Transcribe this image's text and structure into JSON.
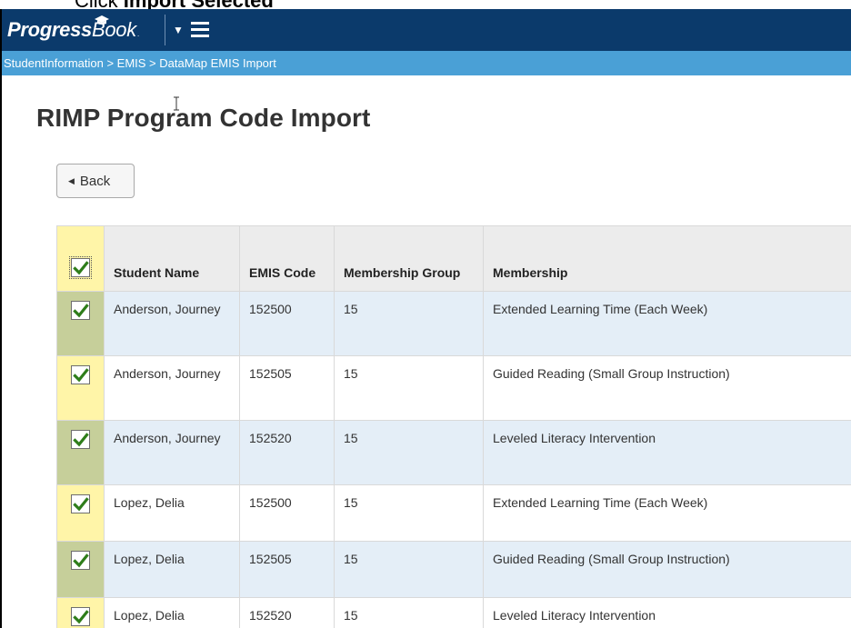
{
  "instruction": {
    "prefix": "Click ",
    "bold": "Import Selected"
  },
  "header": {
    "logo_bold": "Progress",
    "logo_regular": "Book"
  },
  "breadcrumb": "StudentInformation > EMIS > DataMap EMIS Import",
  "page_title": "RIMP Program Code Import",
  "back_button": "Back",
  "colors": {
    "topbar": "#0b3a6b",
    "breadcrumb_bar": "#4aa0d6",
    "highlight": "#fff5a8",
    "check": "#2e7d1a"
  },
  "table": {
    "columns": {
      "student_name": "Student Name",
      "emis_code": "EMIS Code",
      "membership_group": "Membership Group",
      "membership": "Membership"
    },
    "rows": [
      {
        "student_name": "Anderson, Journey",
        "emis_code": "152500",
        "membership_group": "15",
        "membership": "Extended Learning Time (Each Week)",
        "checked": true
      },
      {
        "student_name": "Anderson, Journey",
        "emis_code": "152505",
        "membership_group": "15",
        "membership": "Guided Reading (Small Group Instruction)",
        "checked": true
      },
      {
        "student_name": "Anderson, Journey",
        "emis_code": "152520",
        "membership_group": "15",
        "membership": "Leveled Literacy Intervention",
        "checked": true
      },
      {
        "student_name": "Lopez, Delia",
        "emis_code": "152500",
        "membership_group": "15",
        "membership": "Extended Learning Time (Each Week)",
        "checked": true
      },
      {
        "student_name": "Lopez, Delia",
        "emis_code": "152505",
        "membership_group": "15",
        "membership": "Guided Reading (Small Group Instruction)",
        "checked": true
      },
      {
        "student_name": "Lopez, Delia",
        "emis_code": "152520",
        "membership_group": "15",
        "membership": "Leveled Literacy Intervention",
        "checked": true
      }
    ]
  }
}
